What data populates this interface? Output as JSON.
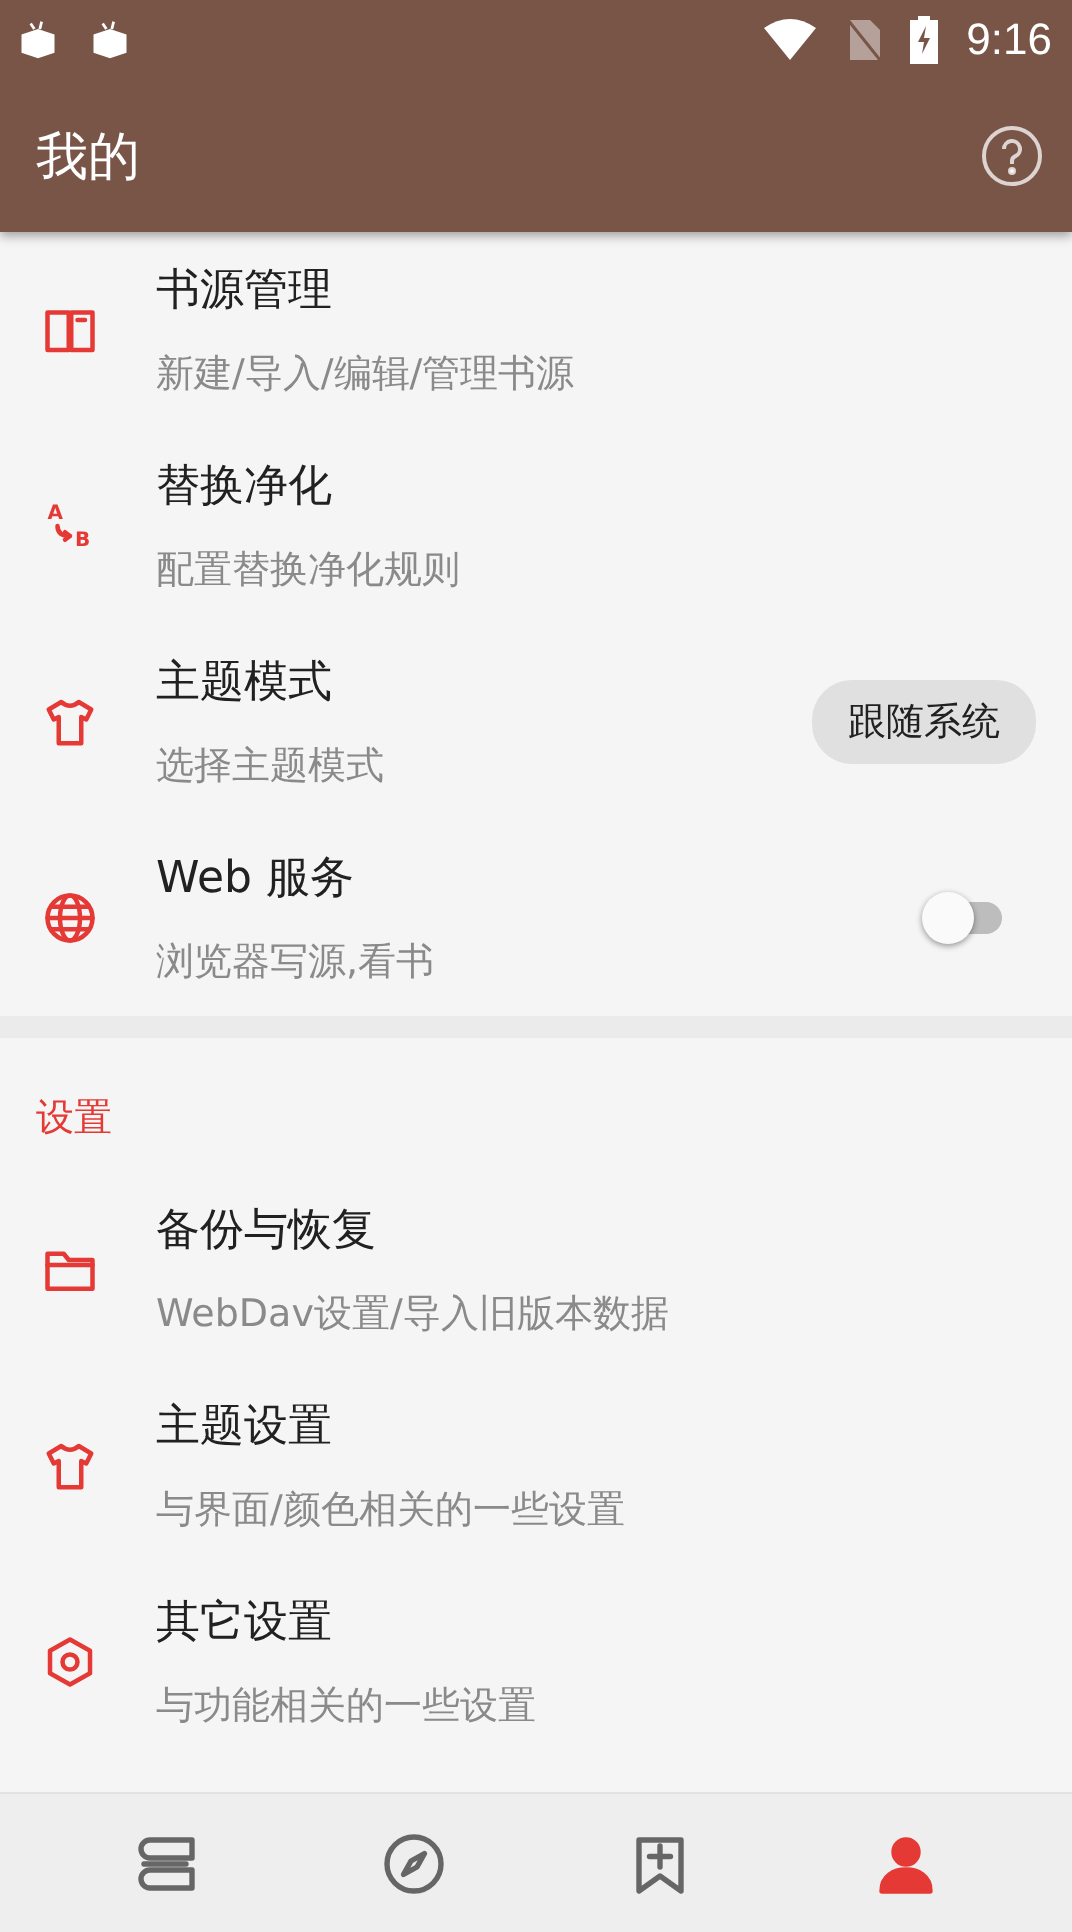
{
  "status_bar": {
    "time": "9:16"
  },
  "app_bar": {
    "title": "我的"
  },
  "items": [
    {
      "title": "书源管理",
      "subtitle": "新建/导入/编辑/管理书源"
    },
    {
      "icon_letters": [
        "A",
        "B"
      ],
      "title": "替换净化",
      "subtitle": "配置替换净化规则"
    },
    {
      "title": "主题模式",
      "subtitle": "选择主题模式",
      "value": "跟随系统"
    },
    {
      "title": "Web 服务",
      "subtitle": "浏览器写源,看书",
      "on": false
    }
  ],
  "settings": {
    "header": "设置",
    "items": [
      {
        "title": "备份与恢复",
        "subtitle": "WebDav设置/导入旧版本数据"
      },
      {
        "title": "主题设置",
        "subtitle": "与界面/颜色相关的一些设置"
      },
      {
        "title": "其它设置",
        "subtitle": "与功能相关的一些设置"
      }
    ]
  },
  "bottom_nav": [
    {
      "selected": false
    },
    {
      "selected": false
    },
    {
      "selected": false
    },
    {
      "selected": true
    }
  ]
}
